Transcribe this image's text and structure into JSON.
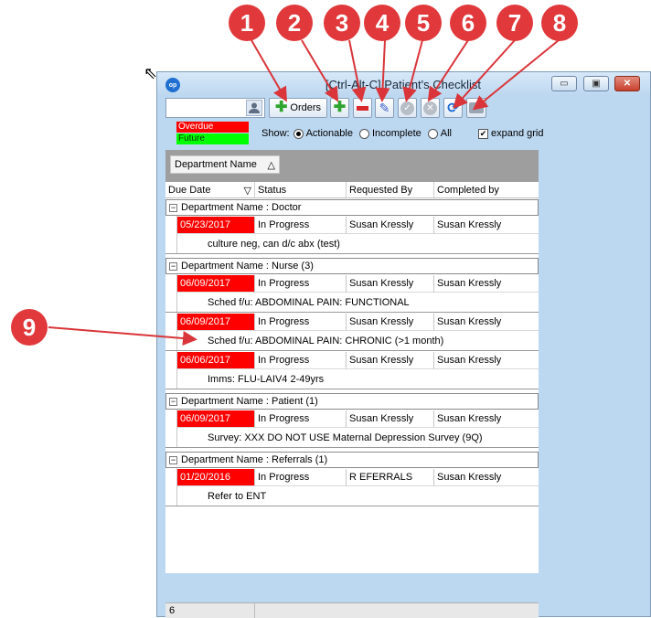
{
  "callouts": [
    "1",
    "2",
    "3",
    "4",
    "5",
    "6",
    "7",
    "8",
    "9"
  ],
  "window": {
    "app_icon": "op",
    "title": "[Ctrl-Alt-C] Patient's Checklist",
    "minimize_label": "▭",
    "maximize_label": "▣",
    "close_label": "✕"
  },
  "toolbar": {
    "patient_placeholder": "",
    "orders_label": "Orders"
  },
  "legend": {
    "overdue": "Overdue",
    "future": "Future",
    "overdue_color": "#ff0000",
    "future_color": "#00ff00"
  },
  "filters": {
    "show_label": "Show:",
    "actionable": "Actionable",
    "incomplete": "Incomplete",
    "all": "All",
    "selected": "Actionable",
    "expand_grid": "expand grid",
    "expand_grid_checked": true
  },
  "grouping": {
    "chip_label": "Department Name",
    "chip_sort_icon": "△"
  },
  "grid": {
    "columns": {
      "due_date": "Due Date",
      "due_date_sort": "▽",
      "status": "Status",
      "requested_by": "Requested By",
      "completed_by": "Completed by"
    },
    "groups": [
      {
        "label": "Department Name : Doctor",
        "items": [
          {
            "due": "05/23/2017",
            "status": "In Progress",
            "requested_by": "Susan Kressly",
            "completed_by": "Susan Kressly",
            "description": "culture neg, can d/c abx (test)"
          }
        ]
      },
      {
        "label": "Department Name : Nurse (3)",
        "items": [
          {
            "due": "06/09/2017",
            "status": "In Progress",
            "requested_by": "Susan Kressly",
            "completed_by": "Susan Kressly",
            "description": "Sched f/u: ABDOMINAL PAIN: FUNCTIONAL"
          },
          {
            "due": "06/09/2017",
            "status": "In Progress",
            "requested_by": "Susan Kressly",
            "completed_by": "Susan Kressly",
            "description": "Sched f/u: ABDOMINAL PAIN: CHRONIC  (>1 month)"
          },
          {
            "due": "06/06/2017",
            "status": "In Progress",
            "requested_by": "Susan Kressly",
            "completed_by": "Susan Kressly",
            "description": "Imms: FLU-LAIV4 2-49yrs"
          }
        ]
      },
      {
        "label": "Department Name : Patient (1)",
        "items": [
          {
            "due": "06/09/2017",
            "status": "In Progress",
            "requested_by": "Susan Kressly",
            "completed_by": "Susan Kressly",
            "description": "Survey: XXX DO NOT USE Maternal Depression Survey (9Q)"
          }
        ]
      },
      {
        "label": "Department Name : Referrals (1)",
        "items": [
          {
            "due": "01/20/2016",
            "status": "In Progress",
            "requested_by": "R EFERRALS",
            "completed_by": "Susan Kressly",
            "description": "Refer to ENT"
          }
        ]
      }
    ],
    "footer_count": "6"
  },
  "icons": {
    "user": "user-lookup-icon",
    "add": "plus-icon",
    "remove": "minus-icon",
    "edit": "pencil-icon",
    "complete": "check-circle-icon",
    "cancel": "cancel-circle-icon",
    "refresh": "refresh-icon",
    "print": "printer-icon"
  }
}
